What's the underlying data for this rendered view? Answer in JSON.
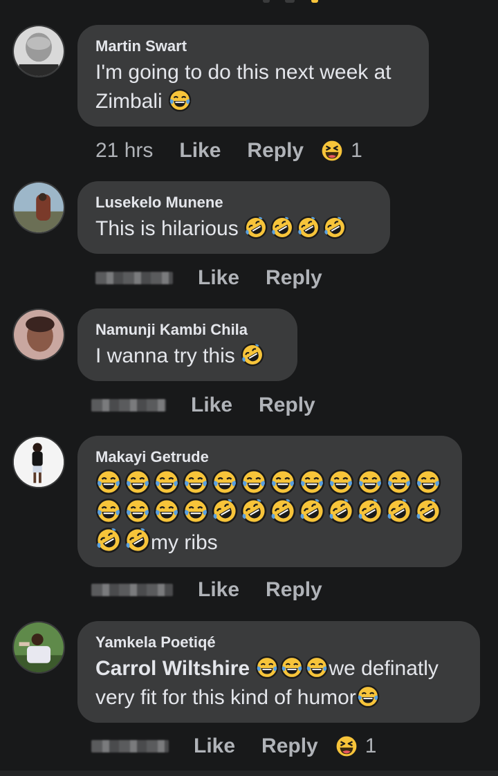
{
  "comments": [
    {
      "author": "Martin Swart",
      "text_lines": [
        "I'm going to do this next week at",
        "Zimbali"
      ],
      "time": "21 hrs",
      "like_label": "Like",
      "reply_label": "Reply",
      "reaction_icon": "haha-reaction-icon",
      "reaction_count": "1"
    },
    {
      "author": "Lusekelo Munene",
      "text": "This is hilarious",
      "like_label": "Like",
      "reply_label": "Reply"
    },
    {
      "author": "Namunji Kambi Chila",
      "text": "I wanna try this",
      "like_label": "Like",
      "reply_label": "Reply"
    },
    {
      "author": "Makayi Getrude",
      "text": "my ribs",
      "like_label": "Like",
      "reply_label": "Reply"
    },
    {
      "author": "Yamkela Poetiqé",
      "mention": "Carrol Wiltshire",
      "text_a": "we definatly",
      "text_b": "very fit for this kind of humor",
      "like_label": "Like",
      "reply_label": "Reply",
      "reaction_icon": "haha-reaction-icon",
      "reaction_count": "1"
    }
  ],
  "colors": {
    "background": "#18191a",
    "bubble": "#3a3b3c",
    "primary_text": "#e4e6eb",
    "secondary_text": "#b0b3b8",
    "emoji_yellow": "#f7c43a"
  }
}
